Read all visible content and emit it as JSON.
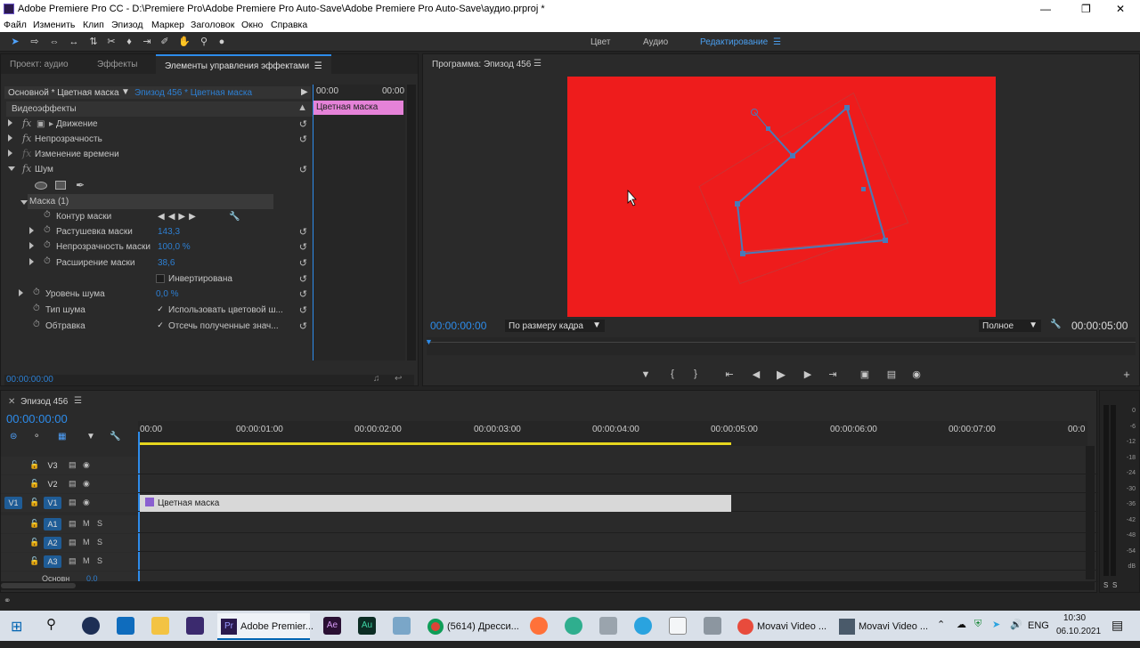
{
  "window": {
    "title": "Adobe Premiere Pro CC - D:\\Premiere Pro\\Adobe Premiere Pro Auto-Save\\Adobe Premiere Pro Auto-Save\\аудио.prproj *"
  },
  "menu": [
    "Файл",
    "Изменить",
    "Клип",
    "Эпизод",
    "Маркер",
    "Заголовок",
    "Окно",
    "Справка"
  ],
  "workspaces": [
    "Цвет",
    "Аудио",
    "Редактирование"
  ],
  "effects_panel": {
    "tabs": [
      "Проект: аудио",
      "Эффекты",
      "Элементы управления эффектами"
    ],
    "source_label": "Основной * Цветная маска",
    "sequence_label": "Эпизод 456 * Цветная маска",
    "mini_time_start": "00:00",
    "mini_time_end": "00:00",
    "clip_label": "Цветная маска",
    "video_effects_header": "Видеоэффекты",
    "effects": [
      "Движение",
      "Непрозрачность",
      "Изменение времени",
      "Шум"
    ],
    "mask_name": "Маска (1)",
    "mask_rows": {
      "path": "Контур маски",
      "feather": "Растушевка маски",
      "feather_value": "143,3",
      "opacity": "Непрозрачность маски",
      "opacity_value": "100,0 %",
      "expansion": "Расширение маски",
      "expansion_value": "38,6",
      "inverted": "Инвертирована"
    },
    "noise_rows": {
      "level": "Уровень шума",
      "level_value": "0,0 %",
      "type": "Тип шума",
      "type_value": "Использовать цветовой ш...",
      "clip": "Обтравка",
      "clip_value": "Отсечь полученные знач..."
    },
    "timecode": "00:00:00:00"
  },
  "program": {
    "tab": "Программа: Эпизод 456",
    "timecode": "00:00:00:00",
    "fit": "По размеру кадра",
    "quality": "Полное",
    "duration": "00:00:05:00",
    "frame_color": "#ee1c1c"
  },
  "timeline": {
    "tab": "Эпизод 456",
    "timecode": "00:00:00:00",
    "ruler": [
      "00:00",
      "00:00:01:00",
      "00:00:02:00",
      "00:00:03:00",
      "00:00:04:00",
      "00:00:05:00",
      "00:00:06:00",
      "00:00:07:00",
      "00:0"
    ],
    "tracks": [
      "V3",
      "V2",
      "V1",
      "A1",
      "A2",
      "A3"
    ],
    "source_patch": "V1",
    "master": "Основн",
    "master_value": "0,0",
    "clip": "Цветная маска"
  },
  "meters": {
    "ticks": [
      "0",
      "-6",
      "-12",
      "-18",
      "-24",
      "-30",
      "-36",
      "-42",
      "-48",
      "-54",
      "dB"
    ],
    "solo": [
      "S",
      "S"
    ]
  },
  "taskbar": {
    "items": [
      "Adobe Premier...",
      "(5614) Дресси...",
      "Movavi Video ...",
      "Movavi Video ..."
    ],
    "lang": "ENG",
    "time": "10:30",
    "date": "06.10.2021"
  }
}
